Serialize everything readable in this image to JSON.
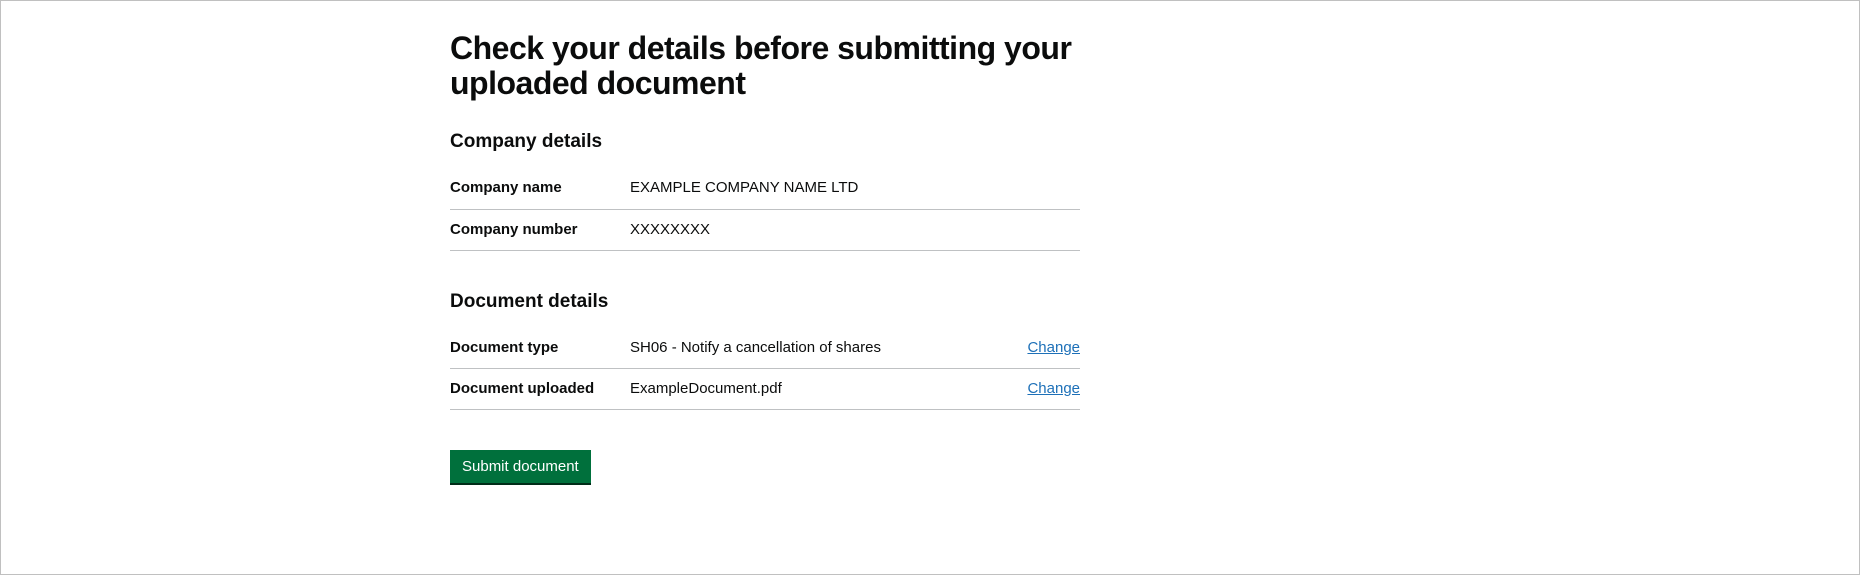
{
  "page": {
    "heading": "Check your details before submitting your uploaded document"
  },
  "company": {
    "section_title": "Company details",
    "name_label": "Company name",
    "name_value": "EXAMPLE COMPANY NAME LTD",
    "number_label": "Company number",
    "number_value": "XXXXXXXX"
  },
  "document": {
    "section_title": "Document details",
    "type_label": "Document type",
    "type_value": "SH06 - Notify a cancellation of shares",
    "type_change": "Change",
    "uploaded_label": "Document uploaded",
    "uploaded_value": "ExampleDocument.pdf",
    "uploaded_change": "Change"
  },
  "actions": {
    "submit": "Submit document"
  }
}
